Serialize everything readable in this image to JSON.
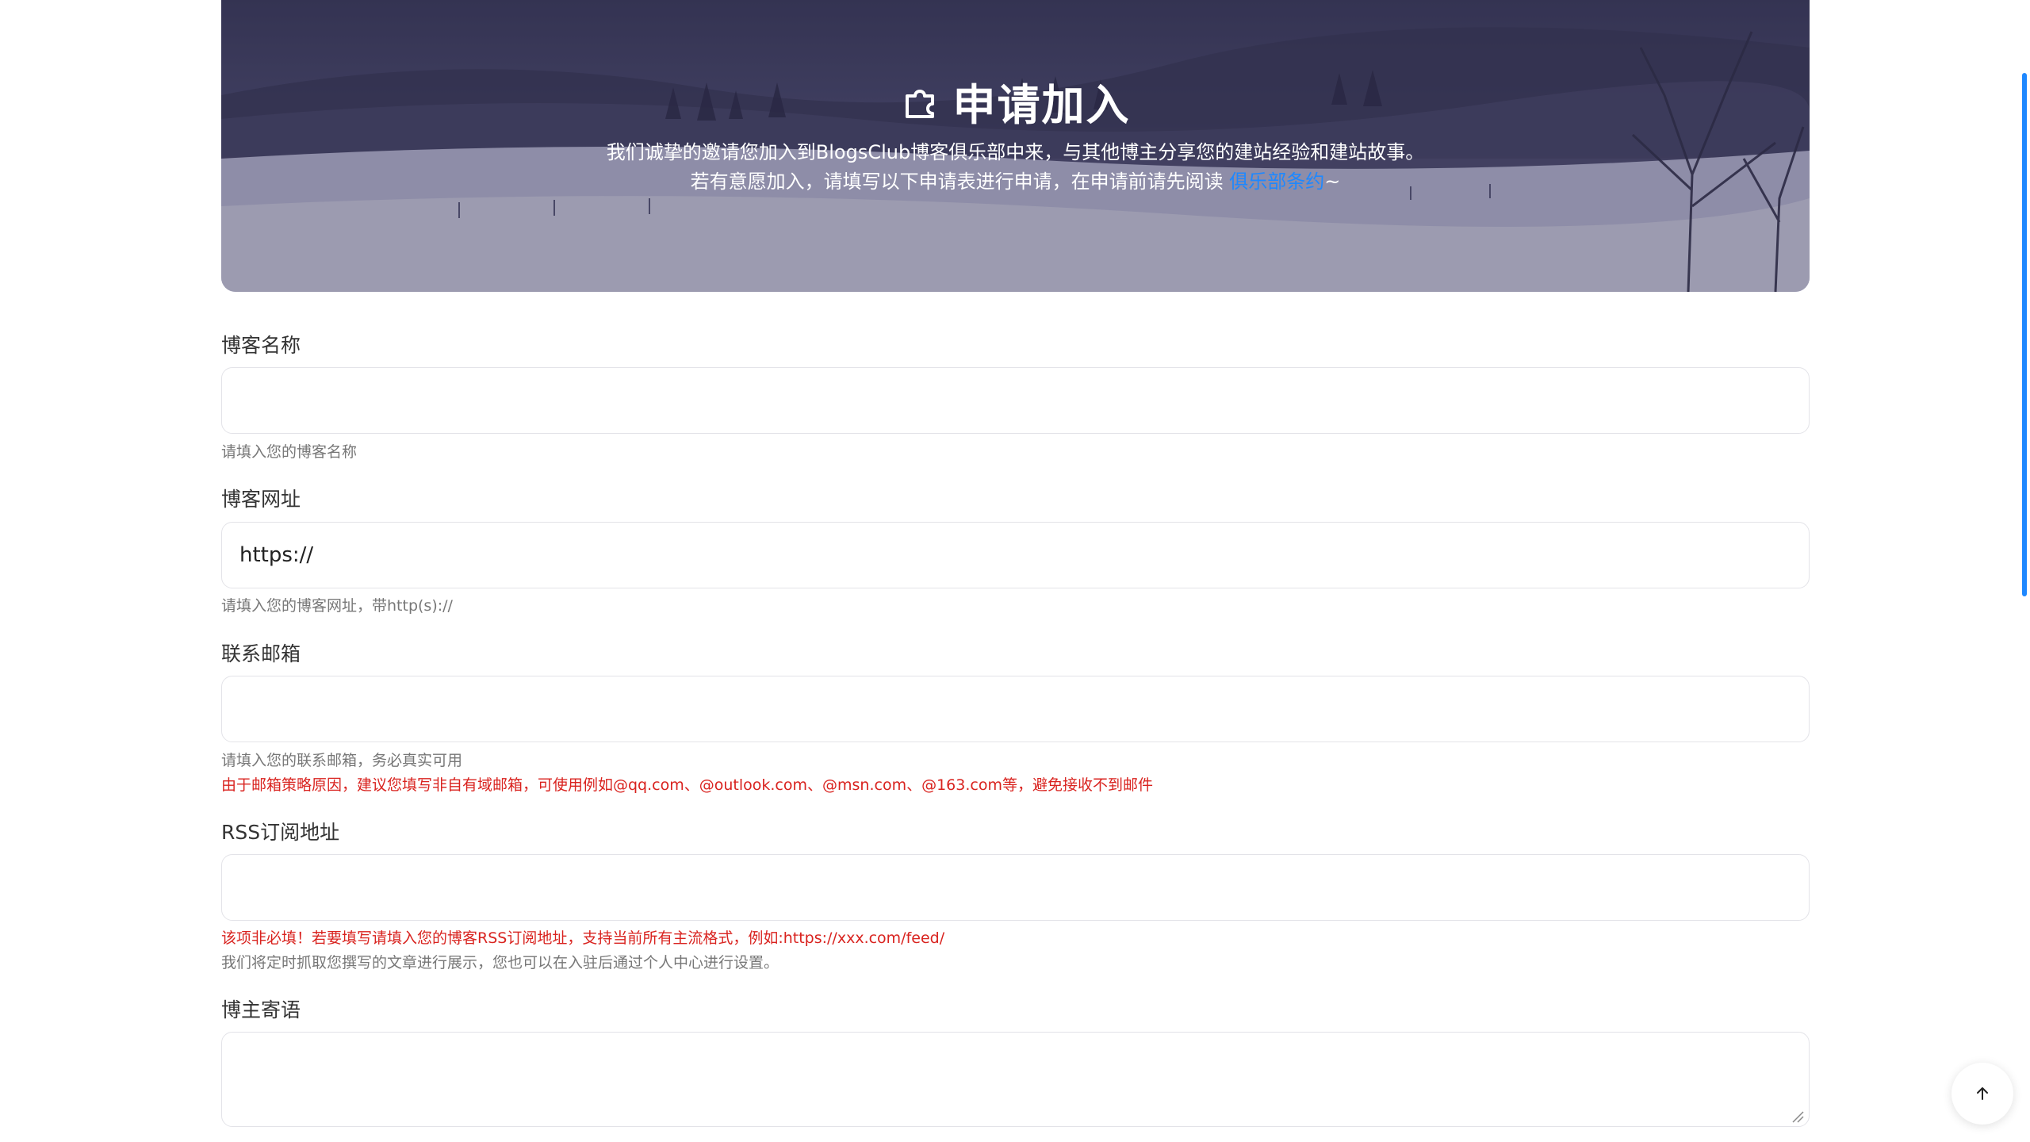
{
  "hero": {
    "title": "申请加入",
    "intro_line1": "我们诚挚的邀请您加入到BlogsClub博客俱乐部中来，与其他博主分享您的建站经验和建站故事。",
    "intro_line2_prefix": "若有意愿加入，请填写以下申请表进行申请，在申请前请先阅读 ",
    "intro_line2_link": "俱乐部条约",
    "intro_line2_suffix": "~"
  },
  "form": {
    "blog_name": {
      "label": "博客名称",
      "value": "",
      "hint": "请填入您的博客名称"
    },
    "blog_url": {
      "label": "博客网址",
      "value": "https://",
      "hint": "请填入您的博客网址，带http(s)://"
    },
    "email": {
      "label": "联系邮箱",
      "value": "",
      "hint": "请填入您的联系邮箱，务必真实可用",
      "warning": "由于邮箱策略原因，建议您填写非自有域邮箱，可使用例如@qq.com、@outlook.com、@msn.com、@163.com等，避免接收不到邮件"
    },
    "rss": {
      "label": "RSS订阅地址",
      "value": "",
      "warning": "该项非必填！若要填写请填入您的博客RSS订阅地址，支持当前所有主流格式，例如:https://xxx.com/feed/",
      "hint": "我们将定时抓取您撰写的文章进行展示，您也可以在入驻后通过个人中心进行设置。"
    },
    "message": {
      "label": "博主寄语",
      "value": ""
    }
  },
  "colors": {
    "accent": "#1e88ff",
    "warning": "#d9231f"
  },
  "icons": {
    "title_icon": "puzzle-icon",
    "back_to_top": "arrow-up-icon"
  }
}
